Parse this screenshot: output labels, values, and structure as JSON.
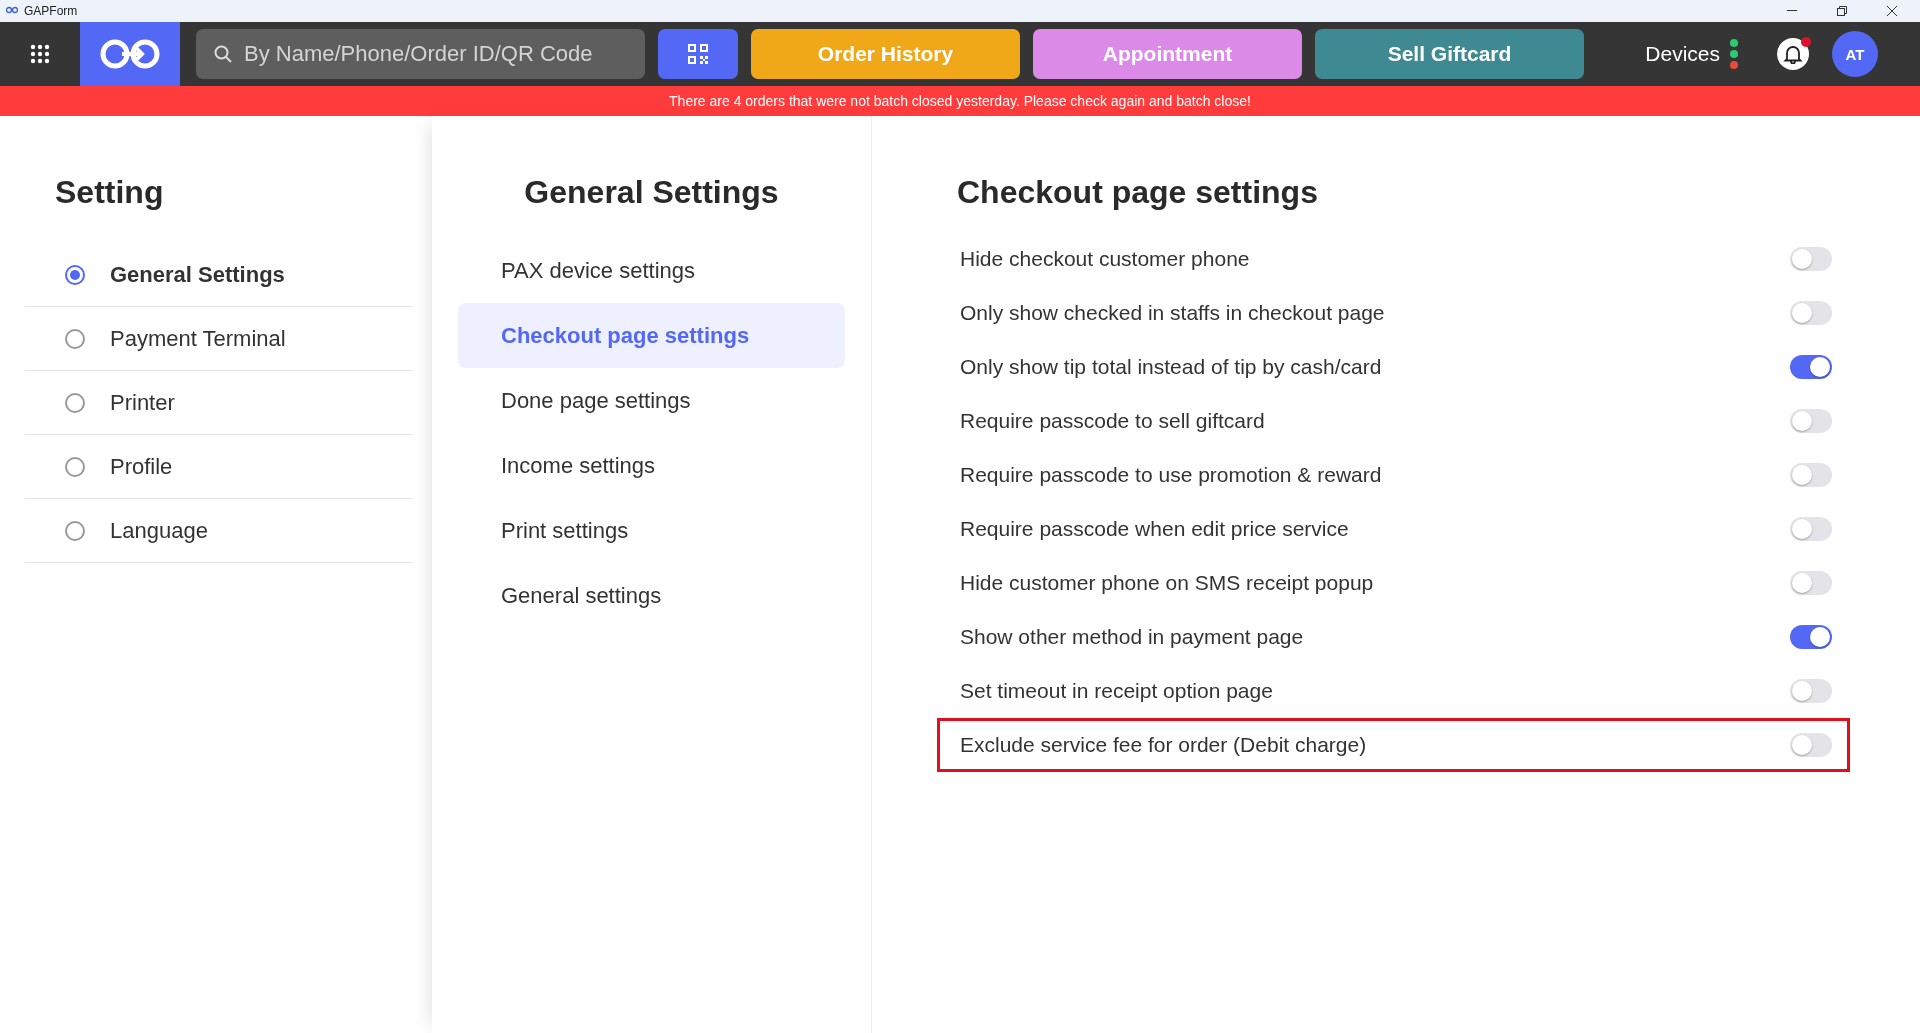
{
  "window": {
    "title": "GAPForm"
  },
  "topbar": {
    "search": {
      "placeholder": "By Name/Phone/Order ID/QR Code"
    },
    "actions": [
      {
        "label": "Order History",
        "color": "#f0a818"
      },
      {
        "label": "Appointment",
        "color": "#dc8ae8"
      },
      {
        "label": "Sell Giftcard",
        "color": "#3f8a92"
      }
    ],
    "devices": {
      "label": "Devices",
      "dots": [
        {
          "color": "#2ecc71"
        },
        {
          "color": "#2ecc71"
        },
        {
          "color": "#e74c3c"
        }
      ]
    },
    "notifications": {
      "unread": true
    },
    "avatar": {
      "initials": "AT"
    }
  },
  "banner": {
    "text": "There are 4 orders that were not batch closed yesterday. Please check again and batch close!"
  },
  "sidebar": {
    "title": "Setting",
    "items": [
      {
        "label": "General Settings",
        "selected": true
      },
      {
        "label": "Payment Terminal",
        "selected": false
      },
      {
        "label": "Printer",
        "selected": false
      },
      {
        "label": "Profile",
        "selected": false
      },
      {
        "label": "Language",
        "selected": false
      }
    ]
  },
  "submenu": {
    "title": "General Settings",
    "items": [
      {
        "label": "PAX device settings",
        "selected": false
      },
      {
        "label": "Checkout page settings",
        "selected": true
      },
      {
        "label": "Done page settings",
        "selected": false
      },
      {
        "label": "Income settings",
        "selected": false
      },
      {
        "label": "Print settings",
        "selected": false
      },
      {
        "label": "General settings",
        "selected": false
      }
    ]
  },
  "content": {
    "title": "Checkout page settings",
    "settings": [
      {
        "label": "Hide checkout customer phone",
        "on": false,
        "highlighted": false
      },
      {
        "label": "Only show checked in staffs in checkout page",
        "on": false,
        "highlighted": false
      },
      {
        "label": "Only show tip total instead of tip by cash/card",
        "on": true,
        "highlighted": false
      },
      {
        "label": "Require passcode to sell giftcard",
        "on": false,
        "highlighted": false
      },
      {
        "label": "Require passcode to use promotion & reward",
        "on": false,
        "highlighted": false
      },
      {
        "label": "Require passcode when edit price service",
        "on": false,
        "highlighted": false
      },
      {
        "label": "Hide customer phone on SMS receipt popup",
        "on": false,
        "highlighted": false
      },
      {
        "label": "Show other method in payment page",
        "on": true,
        "highlighted": false
      },
      {
        "label": "Set timeout in receipt option page",
        "on": false,
        "highlighted": false
      },
      {
        "label": "Exclude service fee for order (Debit charge)",
        "on": false,
        "highlighted": true
      }
    ]
  }
}
